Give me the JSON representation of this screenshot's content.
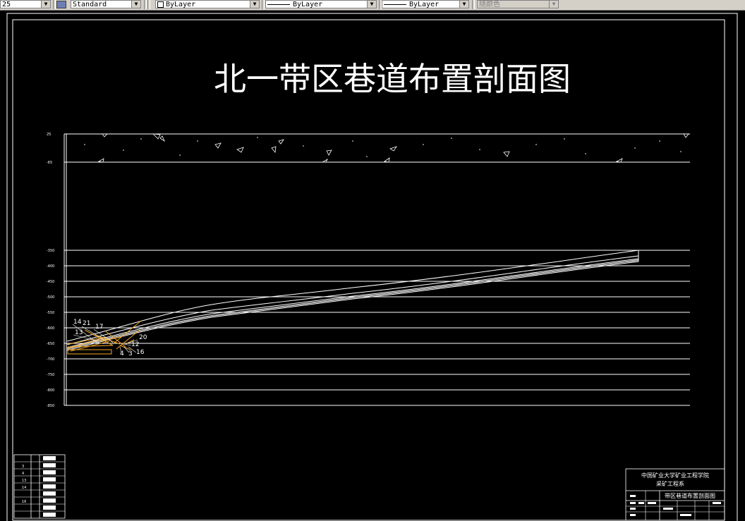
{
  "toolbar": {
    "linewidth": "25",
    "textstyle": "Standard",
    "layer": "ByLayer",
    "linetype": "ByLayer",
    "lineweight": "ByLayer",
    "plotstyle": "随颜色"
  },
  "drawing": {
    "title": "北一带区巷道布置剖面图",
    "levels": [
      "25",
      "-65",
      "-350",
      "-400",
      "-450",
      "-500",
      "-550",
      "-600",
      "-650",
      "-700",
      "-750",
      "-800",
      "-850"
    ],
    "node_labels": [
      "14",
      "21",
      "17",
      "13",
      "20",
      "12",
      "4",
      "3",
      "16"
    ],
    "title_block": {
      "school": "中国矿业大学矿业工程学院",
      "dept": "采矿工程系",
      "drawing_name": "带区巷道布置剖面图"
    },
    "legend_rows": [
      "",
      "3",
      "4",
      "13",
      "14",
      "",
      "16",
      "",
      ""
    ]
  },
  "colors": {
    "background": "#000000",
    "lines": "#ffffff",
    "roadways": "#f5a623"
  }
}
